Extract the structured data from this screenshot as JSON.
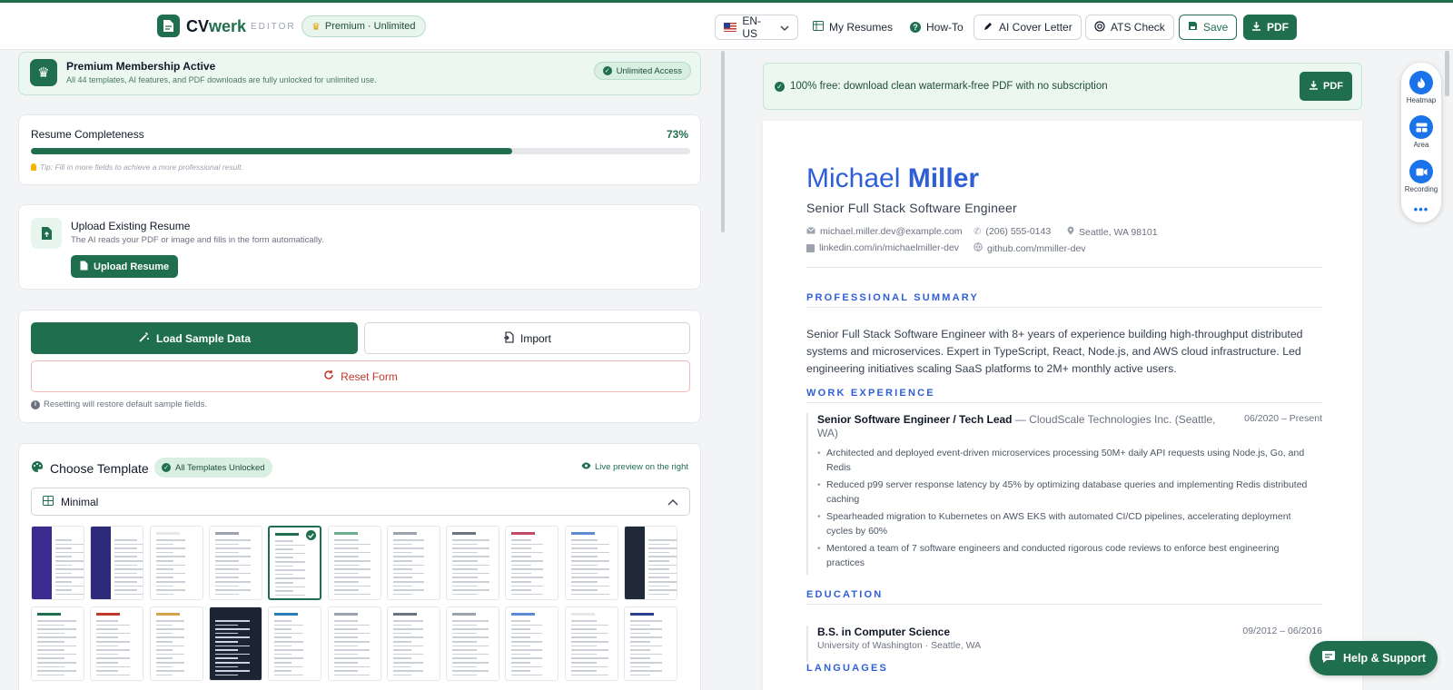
{
  "header": {
    "logo_main": "CV",
    "logo_accent": "werk",
    "editor_tag": "EDITOR",
    "premium_badge": "Premium · Unlimited",
    "language": "EN-US",
    "my_resumes": "My Resumes",
    "how_to": "How-To",
    "ai_cover_letter": "AI Cover Letter",
    "ats_check": "ATS Check",
    "save": "Save",
    "pdf": "PDF"
  },
  "membership": {
    "title": "Premium Membership Active",
    "subtitle": "All 44 templates, AI features, and PDF downloads are fully unlocked for unlimited use.",
    "badge": "Unlimited Access"
  },
  "completeness": {
    "title": "Resume Completeness",
    "percent_label": "73%",
    "percent": 73,
    "tip": "Tip: Fill in more fields to achieve a more professional result."
  },
  "upload": {
    "title": "Upload Existing Resume",
    "subtitle": "The AI reads your PDF or image and fills in the form automatically.",
    "button": "Upload Resume"
  },
  "actions": {
    "load_sample": "Load Sample Data",
    "import": "Import",
    "reset": "Reset Form",
    "note": "Resetting will restore default sample fields."
  },
  "template": {
    "title": "Choose Template",
    "unlocked_badge": "All Templates Unlocked",
    "live_preview": "Live preview on the right",
    "selected": "Minimal",
    "selected_index": 4,
    "thumb_count": 22
  },
  "preview_banner": {
    "text": "100% free: download clean watermark-free PDF with no subscription",
    "button": "PDF"
  },
  "resume": {
    "first_name": "Michael",
    "last_name": "Miller",
    "role": "Senior Full Stack Software Engineer",
    "email": "michael.miller.dev@example.com",
    "phone": "(206) 555-0143",
    "location": "Seattle, WA 98101",
    "linkedin": "linkedin.com/in/michaelmiller-dev",
    "github": "github.com/mmiller-dev",
    "summary_heading": "PROFESSIONAL SUMMARY",
    "summary": "Senior Full Stack Software Engineer with 8+ years of experience building high-throughput distributed systems and microservices. Expert in TypeScript, React, Node.js, and AWS cloud infrastructure. Led engineering initiatives scaling SaaS platforms to 2M+ monthly active users.",
    "work_heading": "WORK EXPERIENCE",
    "job_title": "Senior Software Engineer / Tech Lead",
    "job_company": " — CloudScale Technologies Inc. (Seattle, WA)",
    "job_date": "06/2020 – Present",
    "bullets": [
      "Architected and deployed event-driven microservices processing 50M+ daily API requests using Node.js, Go, and Redis",
      "Reduced p99 server response latency by 45% by optimizing database queries and implementing Redis distributed caching",
      "Spearheaded migration to Kubernetes on AWS EKS with automated CI/CD pipelines, accelerating deployment cycles by 60%",
      "Mentored a team of 7 software engineers and conducted rigorous code reviews to enforce best engineering practices"
    ],
    "education_heading": "EDUCATION",
    "degree": "B.S. in Computer Science",
    "school": "University of Washington · Seattle, WA",
    "edu_date": "09/2012 – 06/2016",
    "languages_heading": "LANGUAGES"
  },
  "tools": {
    "heatmap": "Heatmap",
    "area": "Area",
    "recording": "Recording",
    "more": "•••"
  },
  "help": "Help & Support",
  "colors": {
    "brand_green": "#1f6f4f",
    "resume_blue": "#2f5fd7",
    "tool_blue": "#1a73e8",
    "reset_red": "#c0392b"
  }
}
